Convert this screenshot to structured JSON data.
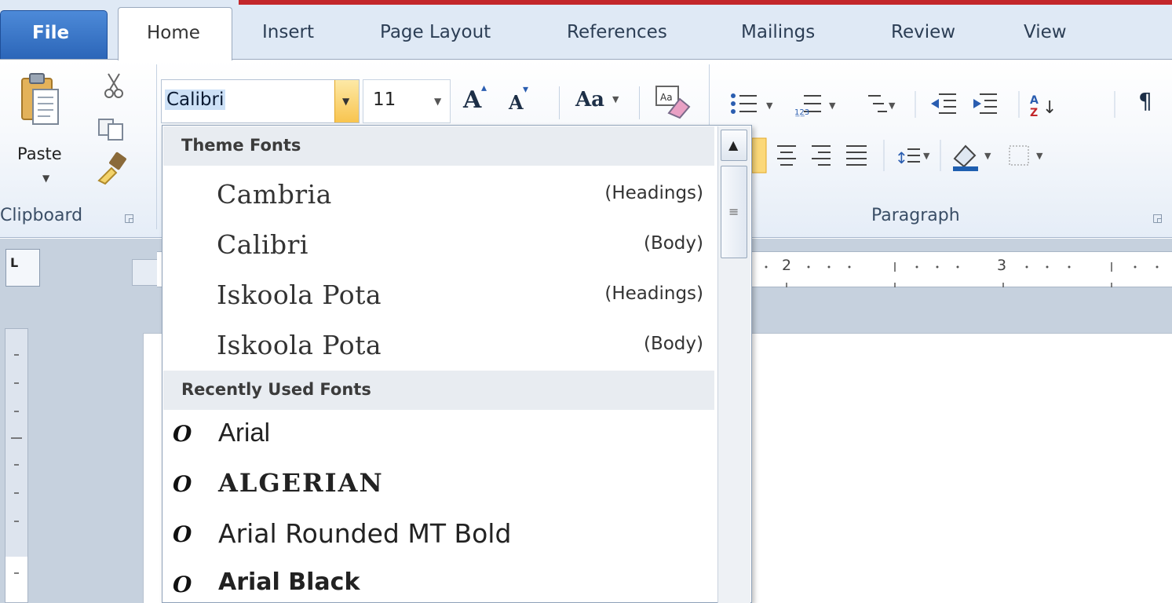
{
  "tabs": {
    "file": "File",
    "home": "Home",
    "insert": "Insert",
    "page_layout": "Page Layout",
    "references": "References",
    "mailings": "Mailings",
    "review": "Review",
    "view": "View"
  },
  "clipboard": {
    "paste_label": "Paste",
    "group_label": "Clipboard",
    "cut_icon": "scissors-icon",
    "copy_icon": "copy-icon",
    "format_painter_icon": "brush-icon",
    "paste_caret": "▼"
  },
  "font_group": {
    "font_name_value": "Calibri",
    "font_size_value": "11",
    "dropdown_caret": "▼",
    "grow_font": "A",
    "shrink_font": "A",
    "change_case": "Aa",
    "clear_format_icon": "eraser-icon"
  },
  "paragraph": {
    "group_label": "Paragraph",
    "pilcrow": "¶"
  },
  "ruler": {
    "mark_2": "2",
    "mark_3": "3",
    "tab_selector": "L"
  },
  "font_dropdown": {
    "theme_header": "Theme Fonts",
    "theme_fonts": [
      {
        "name": "Cambria",
        "tag": "(Headings)"
      },
      {
        "name": "Calibri",
        "tag": "(Body)"
      },
      {
        "name": "Iskoola Pota",
        "tag": "(Headings)"
      },
      {
        "name": "Iskoola Pota",
        "tag": "(Body)"
      }
    ],
    "recent_header": "Recently Used Fonts",
    "recent_fonts": [
      {
        "name": "Arial"
      },
      {
        "name": "ALGERIAN"
      },
      {
        "name": "Arial Rounded MT Bold"
      },
      {
        "name": "Arial Black"
      }
    ],
    "opentype_glyph": "O",
    "scroll_up_glyph": "▲",
    "scroll_grip_glyph": "≡"
  },
  "colors": {
    "file_tab": "#2b65b8",
    "accent_bar": "#c3272b",
    "dropdown_button": "#f8c44f",
    "selection": "#cde1f7"
  }
}
